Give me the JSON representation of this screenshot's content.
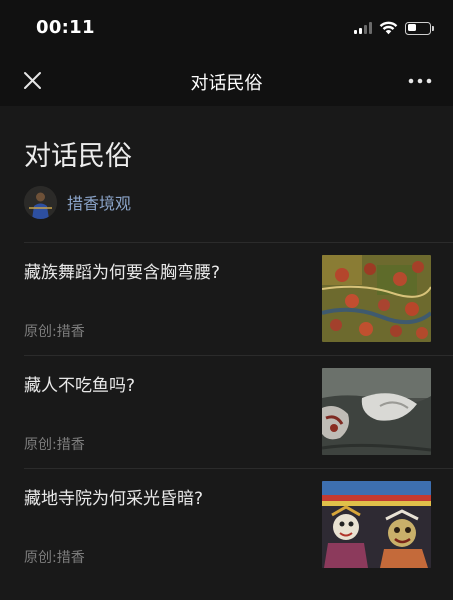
{
  "status_bar": {
    "time": "00:11",
    "signal_icon": "signal-icon",
    "wifi_icon": "wifi-icon",
    "battery_icon": "battery-icon"
  },
  "nav": {
    "title": "对话民俗",
    "close_icon": "close-icon",
    "more_icon": "more-icon"
  },
  "article": {
    "title": "对话民俗",
    "author": "措香境观"
  },
  "items": [
    {
      "title": "藏族舞蹈为何要含胸弯腰?",
      "meta": "原创:措香"
    },
    {
      "title": "藏人不吃鱼吗?",
      "meta": "原创:措香"
    },
    {
      "title": "藏地寺院为何采光昏暗?",
      "meta": "原创:措香"
    }
  ],
  "colors": {
    "background": "#191919",
    "header": "#111111",
    "author_link": "#8aa3c8",
    "meta": "#7c7c7c"
  }
}
